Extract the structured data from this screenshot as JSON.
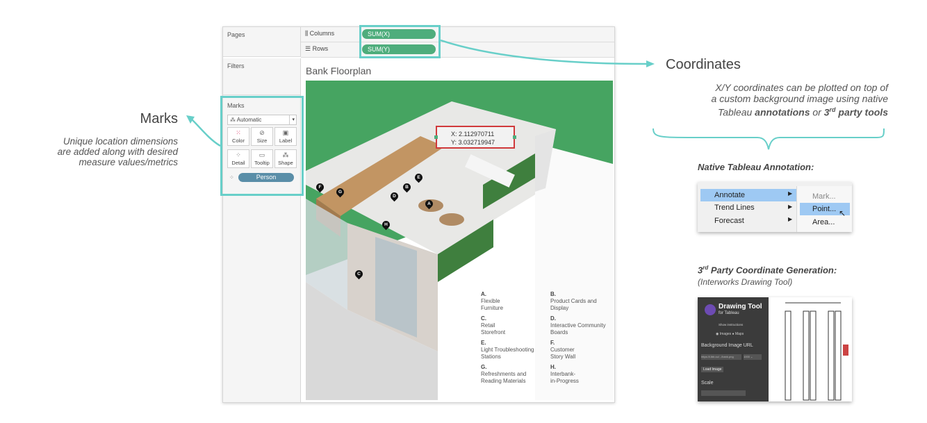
{
  "tableau": {
    "pages_label": "Pages",
    "filters_label": "Filters",
    "columns_label": "Columns",
    "rows_label": "Rows",
    "columns_pill": "SUM(X)",
    "rows_pill": "SUM(Y)",
    "marks": {
      "title": "Marks",
      "type": "Automatic",
      "buttons": [
        "Color",
        "Size",
        "Label",
        "Detail",
        "Tooltip",
        "Shape"
      ],
      "field": "Person"
    },
    "view_title": "Bank Floorplan",
    "tooltip": {
      "x": "X: 2.112970711",
      "y": "Y: 3.032719947"
    },
    "pins": [
      "A",
      "B",
      "C",
      "D",
      "E",
      "F",
      "G",
      "H"
    ],
    "legend": [
      {
        "letter": "A.",
        "text1": "Flexible",
        "text2": "Furniture"
      },
      {
        "letter": "B.",
        "text1": "Product Cards and",
        "text2": "Display"
      },
      {
        "letter": "C.",
        "text1": "Retail",
        "text2": "Storefront"
      },
      {
        "letter": "D.",
        "text1": "Interactive Community",
        "text2": "Boards"
      },
      {
        "letter": "E.",
        "text1": "Light Troubleshooting",
        "text2": "Stations"
      },
      {
        "letter": "F.",
        "text1": "Customer",
        "text2": "Story Wall"
      },
      {
        "letter": "G.",
        "text1": "Refreshments and",
        "text2": "Reading Materials"
      },
      {
        "letter": "H.",
        "text1": "Interbank-",
        "text2": "in-Progress"
      }
    ]
  },
  "marks_callout": {
    "title": "Marks",
    "text": [
      "Unique location dimensions",
      "are added along with desired",
      "measure values/metrics"
    ]
  },
  "coords_callout": {
    "title": "Coordinates",
    "line1": "X/Y coordinates can be plotted on top of",
    "line2": "a custom background image using native",
    "line3_a": "Tableau ",
    "line3_b": "annotations",
    "line3_c": " or ",
    "line3_d": "3",
    "line3_e": "rd",
    "line3_f": " party tools"
  },
  "native_annotation": {
    "title": "Native Tableau Annotation:",
    "menu": [
      "Annotate",
      "Trend Lines",
      "Forecast"
    ],
    "submenu": [
      "Mark...",
      "Point...",
      "Area..."
    ]
  },
  "third_party": {
    "title_a": "3",
    "title_sup": "rd",
    "title_b": " Party Coordinate Generation:",
    "subtitle": "(Interworks Drawing Tool)",
    "tool_title": "Drawing Tool",
    "tool_sub": "for Tableau",
    "show_instructions": "Show instructions",
    "radio_a": "Images",
    "radio_b": "Maps",
    "bg_url_label": "Background Image URL",
    "url_value": "https://i.ibb.co/.../bank.png",
    "url_width": "1000",
    "load_button": "Load Image",
    "scale_label": "Scale"
  },
  "colors": {
    "accent": "#68cfc9",
    "pill_green": "#4ead7c",
    "floor_green": "#46a461",
    "person_pill": "#5a8ea8",
    "tooltip_border": "#d0393b"
  }
}
